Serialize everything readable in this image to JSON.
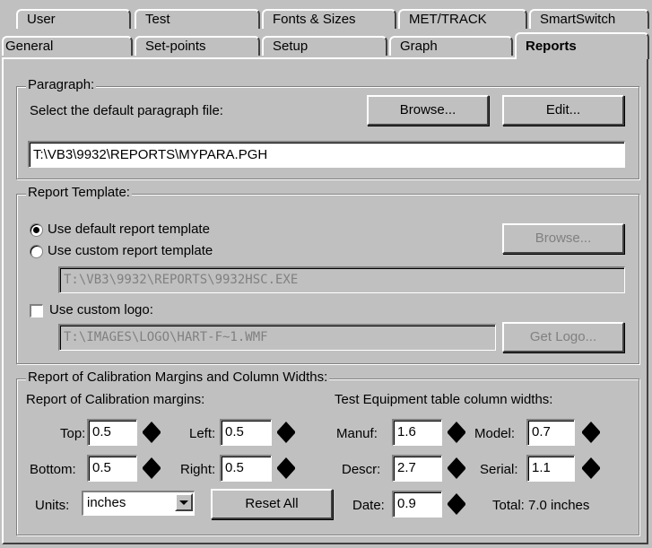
{
  "tabs_back": [
    {
      "label": "User",
      "key": "U"
    },
    {
      "label": "Test",
      "key": "e"
    },
    {
      "label": "Fonts & Sizes",
      "key": "F"
    },
    {
      "label": "MET/TRACK",
      "key": "M"
    },
    {
      "label": "SmartSwitch"
    }
  ],
  "tabs_front": [
    {
      "label": "General"
    },
    {
      "label": "Set-points"
    },
    {
      "label": "Setup"
    },
    {
      "label": "Graph"
    },
    {
      "label": "Reports",
      "active": true
    }
  ],
  "paragraph": {
    "group_label": "Paragraph:",
    "select_label": "Select the default paragraph file:",
    "browse_label": "Browse...",
    "edit_label": "Edit...",
    "file_value": "T:\\VB3\\9932\\REPORTS\\MYPARA.PGH"
  },
  "template": {
    "group_label": "Report Template:",
    "default_option": "Use default report template",
    "custom_option": "Use custom report template",
    "selected": "default",
    "browse_label": "Browse...",
    "custom_path": "T:\\VB3\\9932\\REPORTS\\9932HSC.EXE",
    "logo_label": "Use custom logo:",
    "logo_checked": false,
    "logo_path": "T:\\IMAGES\\LOGO\\HART-F~1.WMF",
    "get_logo_label": "Get Logo..."
  },
  "margins": {
    "group_label": "Report of Calibration Margins and Column Widths:",
    "sub_label": "Report of Calibration margins:",
    "top_label": "Top:",
    "top_value": "0.5",
    "left_label": "Left:",
    "left_value": "0.5",
    "bottom_label": "Bottom:",
    "bottom_value": "0.5",
    "right_label": "Right:",
    "right_value": "0.5",
    "units_label": "Units:",
    "units_value": "inches",
    "reset_label": "Reset All"
  },
  "columns": {
    "sub_label": "Test Equipment table column widths:",
    "manuf_label": "Manuf:",
    "manuf_value": "1.6",
    "model_label": "Model:",
    "model_value": "0.7",
    "descr_label": "Descr:",
    "descr_value": "2.7",
    "serial_label": "Serial:",
    "serial_value": "1.1",
    "date_label": "Date:",
    "date_value": "0.9",
    "total_text": "Total: 7.0 inches"
  }
}
